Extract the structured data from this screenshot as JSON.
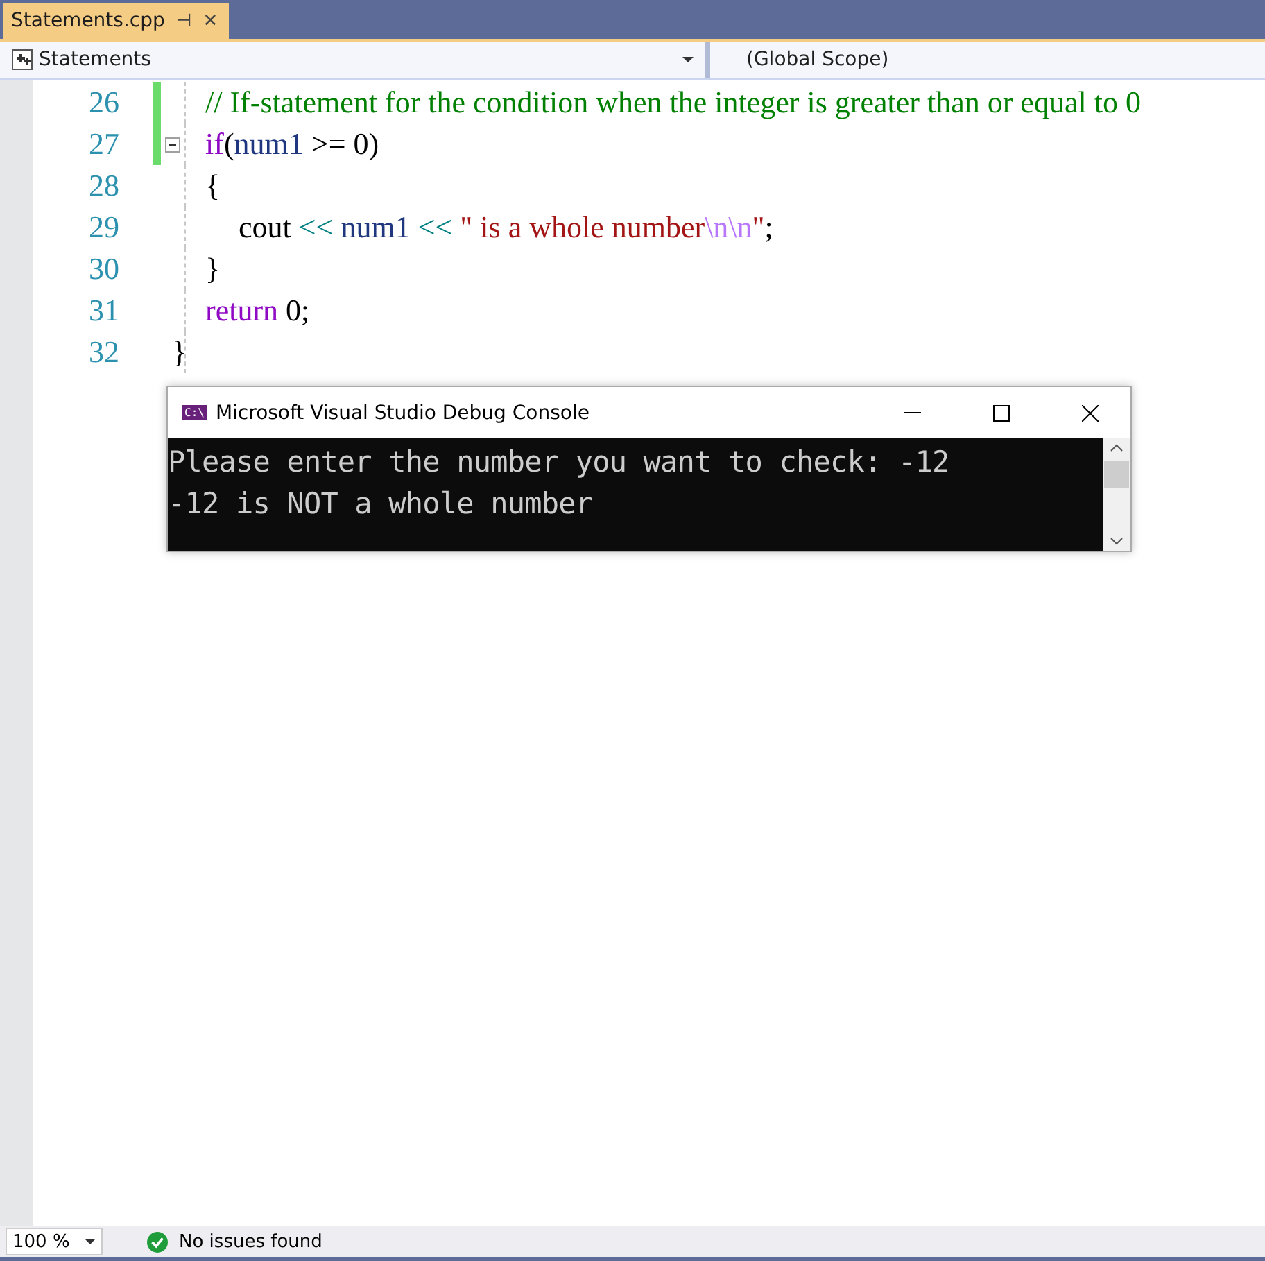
{
  "tabs": [
    {
      "label": "Statements.cpp",
      "selected": true,
      "pin": "⊣",
      "close": "✕"
    }
  ],
  "nav": {
    "project": "Statements",
    "scope": "(Global Scope)"
  },
  "lines": [
    {
      "number": "26",
      "changed": true,
      "tokens": [
        {
          "kind": "comment",
          "text": "// If-statement for the condition when the integer is greater than or equal to 0"
        }
      ]
    },
    {
      "number": "27",
      "changed": true,
      "fold": {
        "expanded": true
      },
      "tokens": [
        {
          "kind": "keyword",
          "text": "if"
        },
        {
          "kind": "plain",
          "text": "("
        },
        {
          "kind": "ident",
          "text": "num1"
        },
        {
          "kind": "plain",
          "text": " >= 0)"
        }
      ]
    },
    {
      "number": "28",
      "changed": false,
      "tokens": [
        {
          "kind": "brace_open",
          "text": "{"
        }
      ]
    },
    {
      "number": "29",
      "changed": false,
      "tokens": [
        {
          "kind": "plain",
          "text": "cout "
        },
        {
          "kind": "op",
          "text": "<<"
        },
        {
          "kind": "ident",
          "text": " num1 "
        },
        {
          "kind": "op",
          "text": "<<"
        },
        {
          "kind": "string",
          "text": " \" is a whole number"
        },
        {
          "kind": "escape",
          "text": "\\n\\n"
        },
        {
          "kind": "string",
          "text": "\""
        },
        {
          "kind": "plain",
          "text": ";"
        }
      ]
    },
    {
      "number": "30",
      "changed": false,
      "tokens": [
        {
          "kind": "brace_close",
          "text": "}"
        }
      ]
    },
    {
      "number": "31",
      "changed": false,
      "tokens": [
        {
          "kind": "keyword",
          "text": "return"
        },
        {
          "kind": "plain",
          "text": " 0;"
        }
      ]
    },
    {
      "number": "32",
      "changed": false,
      "tokens": [
        {
          "kind": "brace_close",
          "text": "}"
        }
      ]
    }
  ],
  "console": {
    "title": "Microsoft Visual Studio Debug Console",
    "icon_text": "C:\\",
    "output": [
      "Please enter the number you want to check: -12",
      "-12 is NOT a whole number"
    ]
  },
  "status": {
    "zoom": "100 %",
    "issues": "No issues found"
  }
}
